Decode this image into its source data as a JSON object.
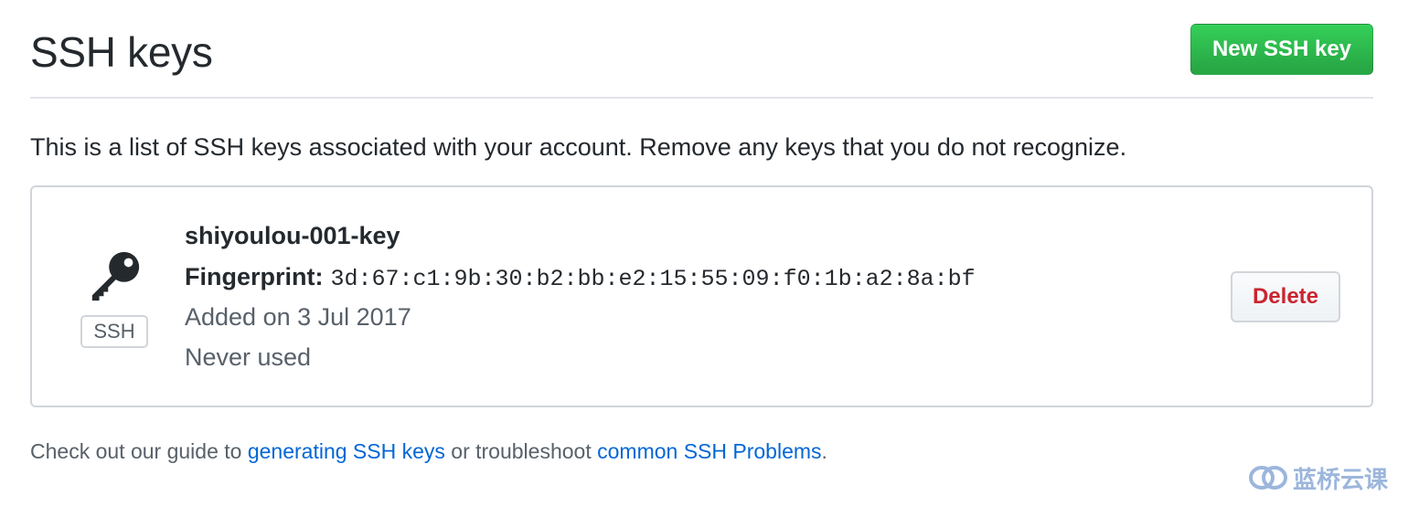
{
  "header": {
    "title": "SSH keys",
    "new_key_button": "New SSH key"
  },
  "intro_text": "This is a list of SSH keys associated with your account. Remove any keys that you do not recognize.",
  "keys": [
    {
      "icon": "key-icon",
      "badge": "SSH",
      "title": "shiyoulou-001-key",
      "fingerprint_label": "Fingerprint:",
      "fingerprint": "3d:67:c1:9b:30:b2:bb:e2:15:55:09:f0:1b:a2:8a:bf",
      "added_on": "Added on 3 Jul 2017",
      "last_used": "Never used",
      "delete_label": "Delete"
    }
  ],
  "footer": {
    "prefix": "Check out our guide to ",
    "link1": "generating SSH keys",
    "middle": " or troubleshoot ",
    "link2": "common SSH Problems",
    "suffix": "."
  },
  "watermark": {
    "text": "蓝桥云课",
    "icon": "lanqiao-logo-icon"
  },
  "colors": {
    "primary_button": "#28a745",
    "danger_text": "#cb2431",
    "link": "#0366d6",
    "muted_text": "#586069",
    "border": "#d1d5da"
  }
}
